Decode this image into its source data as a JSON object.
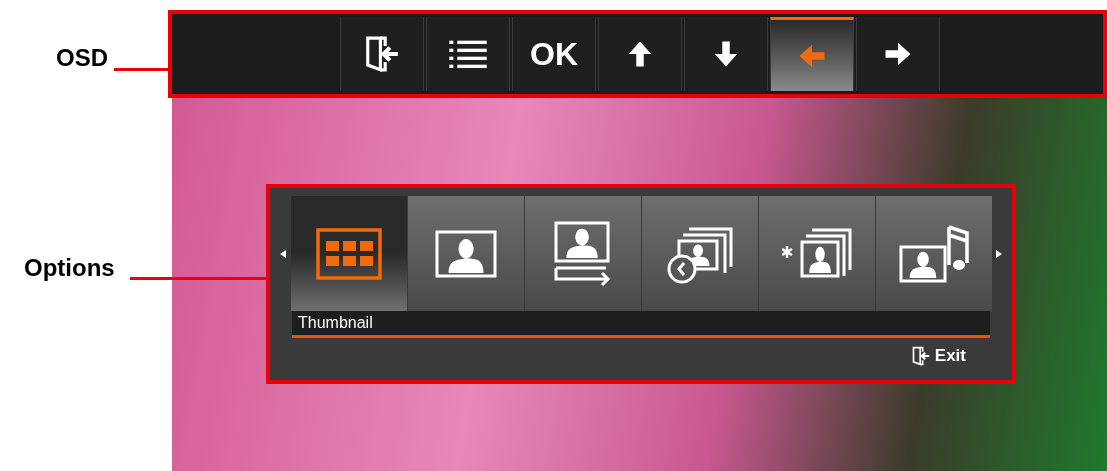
{
  "callouts": [
    {
      "text": "OSD"
    },
    {
      "text": "Options"
    }
  ],
  "osd": {
    "buttons": [
      {
        "kind": "exit",
        "selected": false
      },
      {
        "kind": "list",
        "selected": false
      },
      {
        "kind": "text",
        "label": "OK",
        "selected": false
      },
      {
        "kind": "up",
        "selected": false
      },
      {
        "kind": "down",
        "selected": false
      },
      {
        "kind": "left",
        "selected": true
      },
      {
        "kind": "right",
        "selected": false
      }
    ]
  },
  "options": {
    "items": [
      {
        "kind": "thumbnail",
        "selected": true
      },
      {
        "kind": "photo",
        "selected": false
      },
      {
        "kind": "slideshow",
        "selected": false
      },
      {
        "kind": "timer",
        "selected": false
      },
      {
        "kind": "random",
        "selected": false
      },
      {
        "kind": "music",
        "selected": false
      }
    ],
    "caption": "Thumbnail",
    "exit_label": "Exit"
  }
}
